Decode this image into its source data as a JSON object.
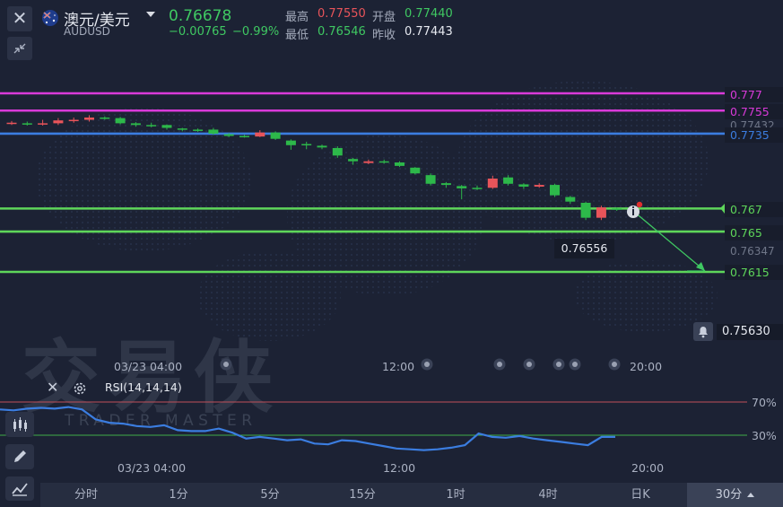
{
  "header": {
    "symbol_name": "澳元/美元",
    "symbol_code": "AUDUSD",
    "last_price": "0.76678",
    "change": "−0.00765",
    "change_pct": "−0.99%",
    "high_label": "最高",
    "high_value": "0.77550",
    "open_label": "开盘",
    "open_value": "0.77440",
    "low_label": "最低",
    "low_value": "0.76546",
    "prev_close_label": "昨收",
    "prev_close_value": "0.77443",
    "dropdown_icon": "caret-down-icon",
    "flag_icon": "flag-au-icon"
  },
  "colors": {
    "up": "#e8545a",
    "down": "#2db84a",
    "magenta": "#d93ad9",
    "blue": "#3b7de0",
    "green_line": "#5ed65a",
    "rsi_line": "#3b7de0",
    "background": "#1c2234"
  },
  "price_levels": [
    {
      "label": "0.777",
      "color": "#d93ad9"
    },
    {
      "label": "0.7755",
      "color": "#d93ad9"
    },
    {
      "label": "0.7735",
      "color": "#3b7de0"
    },
    {
      "label": "0.767",
      "color": "#5ed65a"
    },
    {
      "label": "0.765",
      "color": "#5ed65a"
    },
    {
      "label": "0.7615",
      "color": "#5ed65a"
    }
  ],
  "axis_prices": {
    "top_partial": "0.77432",
    "mid": "0.76347",
    "alert_price": "0.75630"
  },
  "tooltip_price": "0.76556",
  "time_axis": {
    "labels": [
      "03/23 04:00",
      "12:00",
      "20:00"
    ]
  },
  "rsi": {
    "label": "RSI(14,14,14)",
    "levels": [
      "70%",
      "30%"
    ]
  },
  "watermark": {
    "cn": "交易侠",
    "en": "TRADER MASTER"
  },
  "tabs": [
    "分时",
    "1分",
    "5分",
    "15分",
    "1时",
    "4时",
    "日K",
    "30分"
  ],
  "active_tab": "30分",
  "chart_data": {
    "type": "candlestick",
    "candles": [
      {
        "o": 0.7744,
        "c": 0.77445,
        "h": 0.7746,
        "l": 0.77425
      },
      {
        "o": 0.7744,
        "c": 0.77438,
        "h": 0.77455,
        "l": 0.7742
      },
      {
        "o": 0.77435,
        "c": 0.7744,
        "h": 0.7747,
        "l": 0.7742
      },
      {
        "o": 0.7744,
        "c": 0.77465,
        "h": 0.77485,
        "l": 0.77425
      },
      {
        "o": 0.77465,
        "c": 0.7747,
        "h": 0.7749,
        "l": 0.77445
      },
      {
        "o": 0.7747,
        "c": 0.7749,
        "h": 0.7751,
        "l": 0.77455
      },
      {
        "o": 0.7749,
        "c": 0.77485,
        "h": 0.775,
        "l": 0.7747
      },
      {
        "o": 0.77485,
        "c": 0.7744,
        "h": 0.77495,
        "l": 0.7743
      },
      {
        "o": 0.7744,
        "c": 0.77425,
        "h": 0.7745,
        "l": 0.7741
      },
      {
        "o": 0.77425,
        "c": 0.7742,
        "h": 0.77445,
        "l": 0.77405
      },
      {
        "o": 0.77425,
        "c": 0.774,
        "h": 0.7743,
        "l": 0.77385
      },
      {
        "o": 0.77395,
        "c": 0.77385,
        "h": 0.774,
        "l": 0.7737
      },
      {
        "o": 0.77385,
        "c": 0.77378,
        "h": 0.77395,
        "l": 0.77365
      },
      {
        "o": 0.77385,
        "c": 0.7735,
        "h": 0.774,
        "l": 0.7734
      },
      {
        "o": 0.77345,
        "c": 0.7733,
        "h": 0.77355,
        "l": 0.7732
      },
      {
        "o": 0.7733,
        "c": 0.77325,
        "h": 0.7734,
        "l": 0.77315
      },
      {
        "o": 0.77325,
        "c": 0.7736,
        "h": 0.7738,
        "l": 0.7732
      },
      {
        "o": 0.7736,
        "c": 0.77305,
        "h": 0.7737,
        "l": 0.77295
      },
      {
        "o": 0.7729,
        "c": 0.7725,
        "h": 0.773,
        "l": 0.7721
      },
      {
        "o": 0.7726,
        "c": 0.7725,
        "h": 0.7728,
        "l": 0.77215
      },
      {
        "o": 0.77245,
        "c": 0.7723,
        "h": 0.77255,
        "l": 0.77215
      },
      {
        "o": 0.77225,
        "c": 0.7716,
        "h": 0.7724,
        "l": 0.7714
      },
      {
        "o": 0.7713,
        "c": 0.7711,
        "h": 0.7714,
        "l": 0.7708
      },
      {
        "o": 0.77095,
        "c": 0.7711,
        "h": 0.77125,
        "l": 0.77085
      },
      {
        "o": 0.7711,
        "c": 0.771,
        "h": 0.77125,
        "l": 0.7709
      },
      {
        "o": 0.771,
        "c": 0.7707,
        "h": 0.7711,
        "l": 0.7706
      },
      {
        "o": 0.77055,
        "c": 0.77005,
        "h": 0.7706,
        "l": 0.76995
      },
      {
        "o": 0.7699,
        "c": 0.76915,
        "h": 0.77005,
        "l": 0.769
      },
      {
        "o": 0.7692,
        "c": 0.76905,
        "h": 0.7693,
        "l": 0.7688
      },
      {
        "o": 0.76895,
        "c": 0.76875,
        "h": 0.76905,
        "l": 0.7678
      },
      {
        "o": 0.7688,
        "c": 0.76875,
        "h": 0.769,
        "l": 0.7686
      },
      {
        "o": 0.7688,
        "c": 0.7696,
        "h": 0.76985,
        "l": 0.7687
      },
      {
        "o": 0.7697,
        "c": 0.76915,
        "h": 0.7699,
        "l": 0.769
      },
      {
        "o": 0.7691,
        "c": 0.7689,
        "h": 0.7692,
        "l": 0.7687
      },
      {
        "o": 0.7689,
        "c": 0.76905,
        "h": 0.7692,
        "l": 0.7688
      },
      {
        "o": 0.76905,
        "c": 0.76815,
        "h": 0.76915,
        "l": 0.768
      },
      {
        "o": 0.768,
        "c": 0.7676,
        "h": 0.7681,
        "l": 0.7674
      },
      {
        "o": 0.7675,
        "c": 0.7662,
        "h": 0.7676,
        "l": 0.766
      },
      {
        "o": 0.7662,
        "c": 0.7671,
        "h": 0.76725,
        "l": 0.766
      },
      {
        "o": 0.767,
        "c": 0.7669,
        "h": 0.7671,
        "l": 0.7668
      }
    ],
    "rsi": [
      61,
      60,
      62,
      63,
      62,
      64,
      61,
      49,
      45,
      44,
      41,
      40,
      42,
      36,
      35,
      35,
      38,
      33,
      26,
      28,
      26,
      24,
      25,
      20,
      19,
      24,
      23,
      20,
      17,
      14,
      13,
      12,
      13,
      15,
      18,
      32,
      28,
      27,
      29,
      26,
      24,
      22,
      20,
      18,
      28,
      28
    ],
    "rsi_levels": [
      70,
      30
    ]
  }
}
